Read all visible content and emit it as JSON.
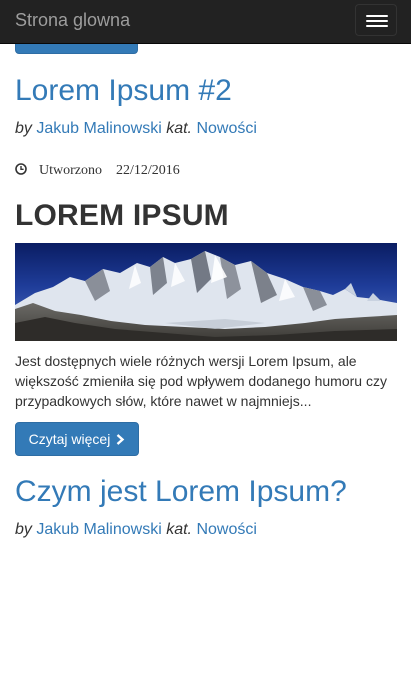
{
  "navbar": {
    "brand": "Strona glowna"
  },
  "posts": [
    {
      "title": "Lorem Ipsum #2",
      "by_label": "by",
      "author": "Jakub Malinowski",
      "category_label": "kat.",
      "category": "Nowości",
      "created_label": "Utworzono",
      "created_date": "22/12/2016",
      "heading": "LOREM IPSUM",
      "excerpt": "Jest dostępnych wiele różnych wersji Lorem Ipsum, ale większość zmieniła się pod wpływem dodanego humoru czy przypadkowych słów, które nawet w najmniejs...",
      "read_more": "Czytaj więcej"
    },
    {
      "title": "Czym jest Lorem Ipsum?",
      "by_label": "by",
      "author": "Jakub Malinowski",
      "category_label": "kat.",
      "category": "Nowości"
    }
  ],
  "icons": {
    "menu": "hamburger-menu-icon",
    "clock": "clock-icon",
    "read_more": "chevron-right-icon"
  },
  "colors": {
    "navbar_bg": "#222222",
    "brand_text": "#9d9d9d",
    "link": "#337ab7",
    "button_bg": "#337ab7",
    "text": "#333333"
  }
}
